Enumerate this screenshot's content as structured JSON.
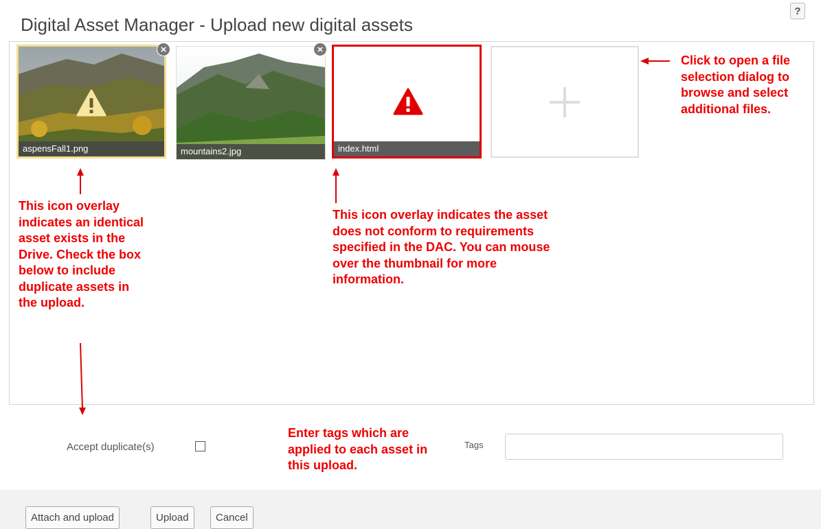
{
  "header": {
    "title": "Digital Asset Manager - Upload new digital assets",
    "help_label": "?"
  },
  "assets": [
    {
      "name": "aspensFall1.png",
      "status": "duplicate",
      "overlay_icon": "warning-triangle-icon",
      "overlay_color": "#f5e7a0"
    },
    {
      "name": "mountains2.jpg",
      "status": "ok"
    },
    {
      "name": "index.html",
      "status": "invalid",
      "overlay_icon": "warning-triangle-icon",
      "overlay_color": "#e00000"
    }
  ],
  "remove_label": "×",
  "add_tile_icon": "plus-icon",
  "annotations": {
    "duplicate": [
      "This icon overlay",
      "indicates an identical",
      "asset exists in the",
      "Drive. Check the box",
      "below to include",
      "duplicate assets in",
      "the upload."
    ],
    "invalid": [
      "This icon overlay indicates the asset",
      "does not conform to requirements",
      "specified in the DAC. You can mouse",
      "over the thumbnail for more",
      "information."
    ],
    "add": [
      "Click to open a file",
      "selection dialog to",
      "browse and select",
      "additional files."
    ],
    "tags": [
      "Enter tags which are",
      "applied to each asset in",
      "this upload."
    ]
  },
  "form": {
    "accept_duplicates_label": "Accept duplicate(s)",
    "accept_duplicates_checked": false,
    "tags_label": "Tags",
    "tags_value": ""
  },
  "buttons": {
    "attach_upload": "Attach and upload",
    "upload": "Upload",
    "cancel": "Cancel"
  },
  "colors": {
    "annotation": "#e00000",
    "selected_border": "#f3dd8e",
    "invalid_border": "#e00000"
  }
}
